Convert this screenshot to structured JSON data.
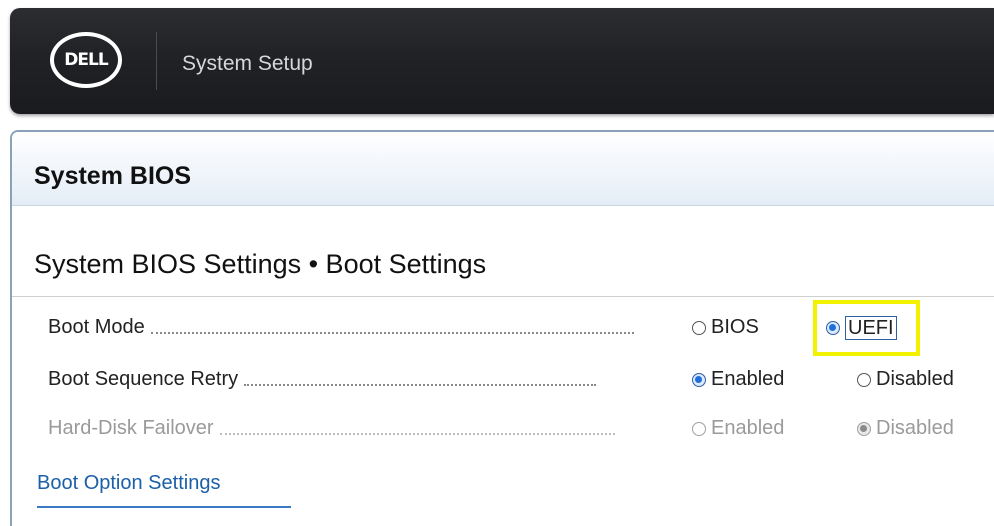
{
  "header": {
    "logo_text": "DELL",
    "title": "System Setup"
  },
  "panel": {
    "title": "System BIOS",
    "section_title": "System BIOS Settings • Boot Settings"
  },
  "settings": [
    {
      "label": "Boot Mode",
      "enabled": true,
      "options": [
        {
          "label": "BIOS",
          "selected": false
        },
        {
          "label": "UEFI",
          "selected": true,
          "focused": true
        }
      ]
    },
    {
      "label": "Boot Sequence Retry",
      "enabled": true,
      "options": [
        {
          "label": "Enabled",
          "selected": true
        },
        {
          "label": "Disabled",
          "selected": false
        }
      ]
    },
    {
      "label": "Hard-Disk Failover",
      "enabled": false,
      "options": [
        {
          "label": "Enabled",
          "selected": false
        },
        {
          "label": "Disabled",
          "selected": true
        }
      ]
    }
  ],
  "links": {
    "boot_option_settings": "Boot Option Settings"
  },
  "colors": {
    "header_bg": "#212226",
    "accent": "#1e6fd9",
    "highlight": "#f2f200",
    "link": "#1b5fa8"
  }
}
